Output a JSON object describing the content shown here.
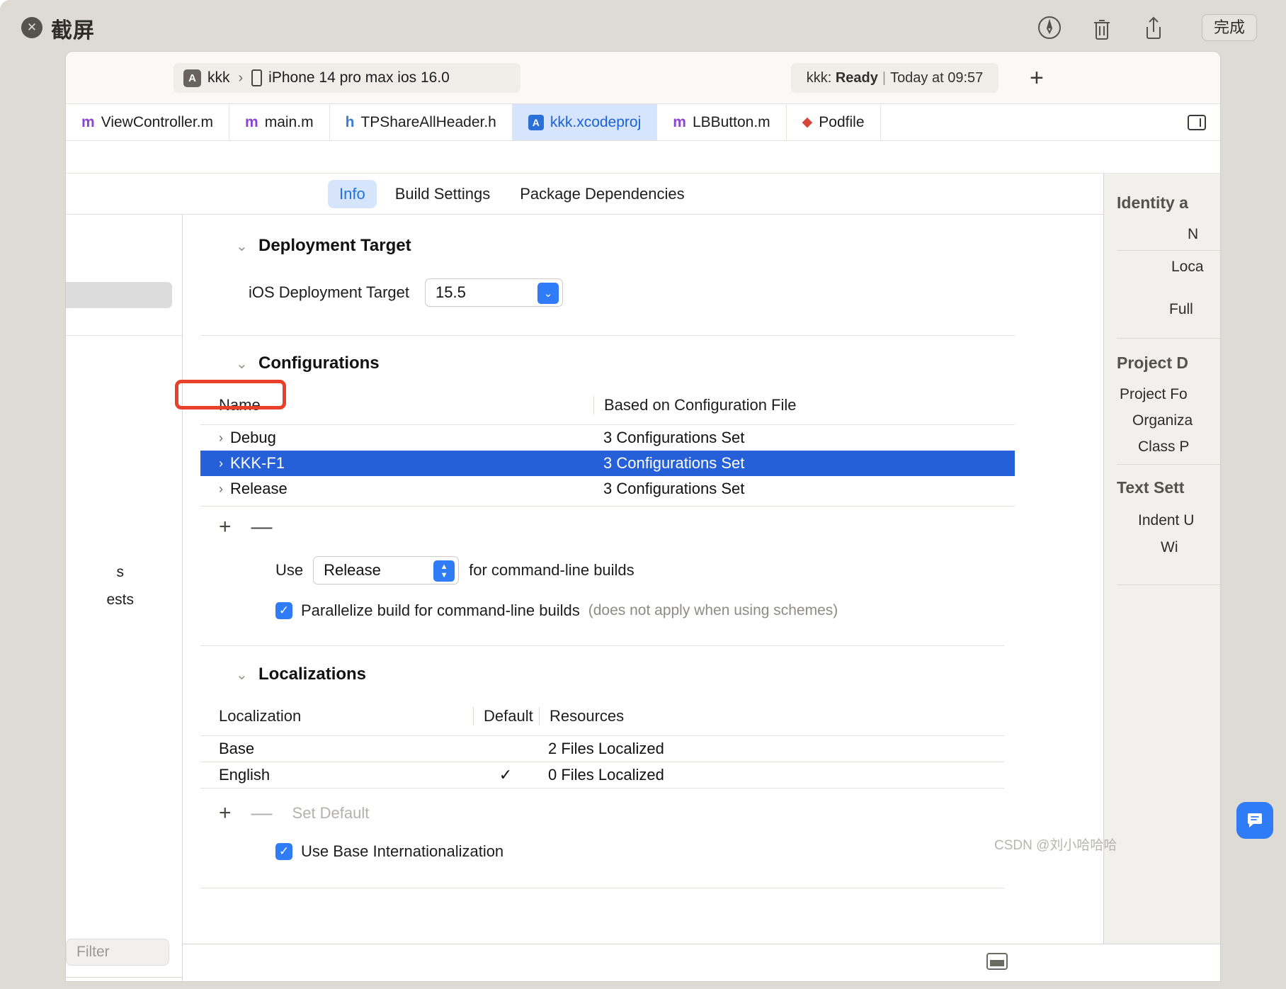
{
  "preview": {
    "title": "截屏",
    "close_label": "✕",
    "markup_icon": "markup-pen-icon",
    "trash_icon": "trash-icon",
    "share_icon": "share-icon",
    "done_label": "完成"
  },
  "toolbar": {
    "scheme_name": "kkk",
    "separator": "›",
    "destination": "iPhone 14 pro max ios 16.0",
    "status_prefix": "kkk:",
    "status_state": "Ready",
    "status_sep": "|",
    "status_time": "Today at 09:57",
    "add_label": "+"
  },
  "tabs": [
    {
      "icon": "m",
      "label": "ViewController.m",
      "active": false
    },
    {
      "icon": "m",
      "label": "main.m",
      "active": false
    },
    {
      "icon": "h",
      "label": "TPShareAllHeader.h",
      "active": false
    },
    {
      "icon": "proj",
      "label": "kkk.xcodeproj",
      "active": true
    },
    {
      "icon": "m",
      "label": "LBButton.m",
      "active": false
    },
    {
      "icon": "gem",
      "label": "Podfile",
      "active": false
    }
  ],
  "segments": [
    {
      "label": "Info",
      "active": true
    },
    {
      "label": "Build Settings",
      "active": false
    },
    {
      "label": "Package Dependencies",
      "active": false
    }
  ],
  "navigator": {
    "clipped_item_1": "s",
    "clipped_item_2": "ests",
    "filter_placeholder": "Filter"
  },
  "deployment": {
    "section_title": "Deployment Target",
    "field_label": "iOS Deployment Target",
    "value": "15.5"
  },
  "configurations": {
    "section_title": "Configurations",
    "columns": [
      "Name",
      "Based on Configuration File"
    ],
    "rows": [
      {
        "name": "Debug",
        "based_on": "3 Configurations Set",
        "selected": false
      },
      {
        "name": "KKK-F1",
        "based_on": "3 Configurations Set",
        "selected": true
      },
      {
        "name": "Release",
        "based_on": "3 Configurations Set",
        "selected": false
      }
    ],
    "add_label": "+",
    "remove_label": "—",
    "use_label": "Use",
    "use_value": "Release",
    "use_suffix": "for command-line builds",
    "parallelize_label": "Parallelize build for command-line builds",
    "parallelize_hint": "(does not apply when using schemes)",
    "check_glyph": "✓"
  },
  "localizations": {
    "section_title": "Localizations",
    "columns": [
      "Localization",
      "Default",
      "Resources"
    ],
    "rows": [
      {
        "localization": "Base",
        "default": "",
        "resources": "2 Files Localized"
      },
      {
        "localization": "English",
        "default": "✓",
        "resources": "0 Files Localized"
      }
    ],
    "add_label": "+",
    "remove_label": "—",
    "set_default_label": "Set Default",
    "use_base_label": "Use Base Internationalization",
    "check_glyph": "✓"
  },
  "inspector": {
    "identity_header": "Identity a",
    "name_label": "N",
    "location_label": "Loca",
    "full_label": "Full",
    "project_doc_header": "Project D",
    "project_format_label": "Project Fo",
    "organization_label": "Organiza",
    "class_prefix_label": "Class P",
    "text_settings_header": "Text Sett",
    "indent_label": "Indent U",
    "width_label": "Wi"
  },
  "colors": {
    "selection_blue": "#2660d8",
    "accent_blue": "#2f7cf6",
    "tab_active_bg": "#d6e5fb",
    "annotation_red": "#e8402a",
    "chrome_bg": "#dedbd4"
  },
  "watermark": "CSDN @刘小哈哈哈"
}
